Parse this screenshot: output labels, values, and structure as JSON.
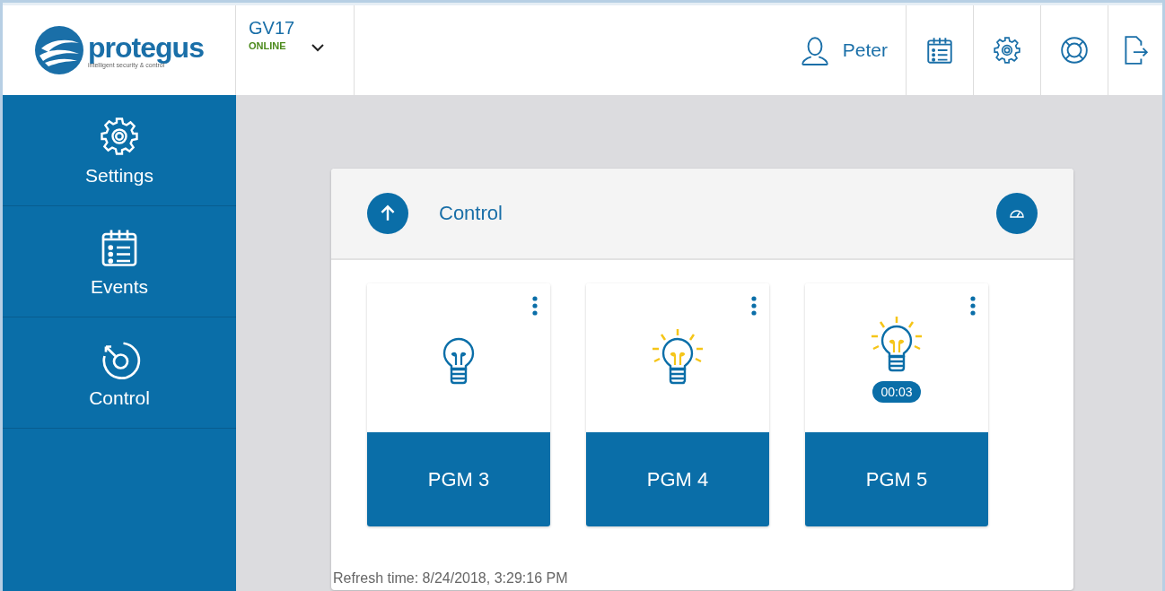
{
  "brand": {
    "name": "protegus",
    "tagline": "intelligent security & control"
  },
  "device": {
    "name": "GV17",
    "status": "ONLINE"
  },
  "user": {
    "name": "Peter"
  },
  "header_actions": [
    {
      "kind": "events"
    },
    {
      "kind": "settings"
    },
    {
      "kind": "help"
    },
    {
      "kind": "logout"
    }
  ],
  "sidebar": {
    "items": [
      {
        "kind": "settings",
        "label": "Settings"
      },
      {
        "kind": "events",
        "label": "Events"
      },
      {
        "kind": "control",
        "label": "Control"
      }
    ]
  },
  "panel": {
    "title": "Control",
    "outputs": [
      {
        "label": "PGM 3",
        "on": false
      },
      {
        "label": "PGM 4",
        "on": true
      },
      {
        "label": "PGM 5",
        "on": true,
        "timer": "00:03"
      }
    ],
    "refresh": "Refresh time: 8/24/2018, 3:29:16 PM"
  }
}
